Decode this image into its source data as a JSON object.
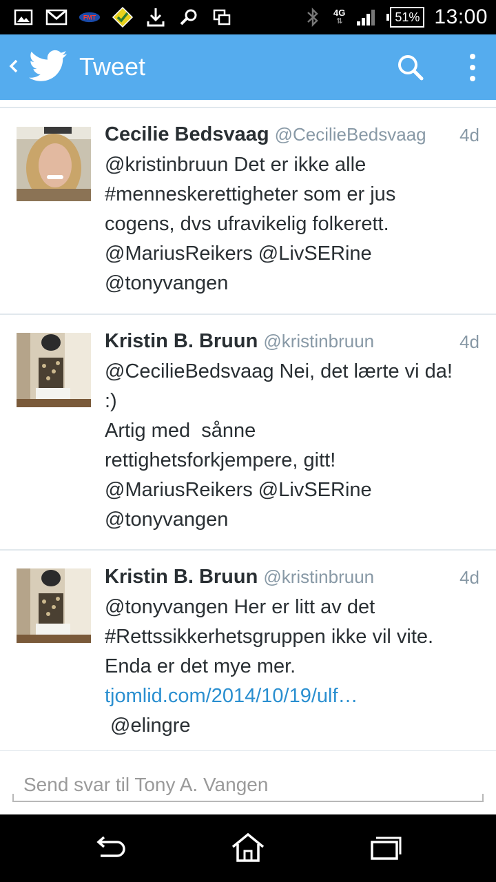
{
  "status_bar": {
    "left_icons": [
      "image-icon",
      "gmail-icon",
      "fmt-icon",
      "app-icon",
      "download-icon",
      "tools-icon",
      "screen-icon"
    ],
    "fmt_label": "FMT",
    "network_label": "4G",
    "battery_percent": "51%",
    "time": "13:00"
  },
  "app_bar": {
    "title": "Tweet"
  },
  "tweets": [
    {
      "name": "Cecilie Bedsvaag",
      "handle": "@CecilieBedsvaag",
      "time": "4d",
      "lines": [
        "@kristinbruun Det er ikke alle",
        "#menneskerettigheter som er jus",
        "cogens, dvs ufravikelig folkerett.",
        "@MariusReikers @LivSERine",
        "@tonyvangen"
      ]
    },
    {
      "name": "Kristin B. Bruun",
      "handle": "@kristinbruun",
      "time": "4d",
      "lines": [
        "@CecilieBedsvaag Nei, det lærte vi da!",
        ":)",
        "Artig med  sånne",
        "rettighetsforkjempere, gitt!",
        "@MariusReikers @LivSERine",
        "@tonyvangen"
      ]
    },
    {
      "name": "Kristin B. Bruun",
      "handle": "@kristinbruun",
      "time": "4d",
      "lines": [
        "@tonyvangen Her er litt av det",
        "#Rettssikkerhetsgruppen ikke vil vite.",
        "Enda er det mye mer."
      ],
      "link": "tjomlid.com/2014/10/19/ulf…",
      "trailing": " @elingre"
    }
  ],
  "reply": {
    "placeholder": "Send svar til Tony A. Vangen"
  },
  "colors": {
    "app_bar": "#55acee",
    "link": "#2a8fd0",
    "text": "#292f33",
    "muted": "#8899a6"
  }
}
